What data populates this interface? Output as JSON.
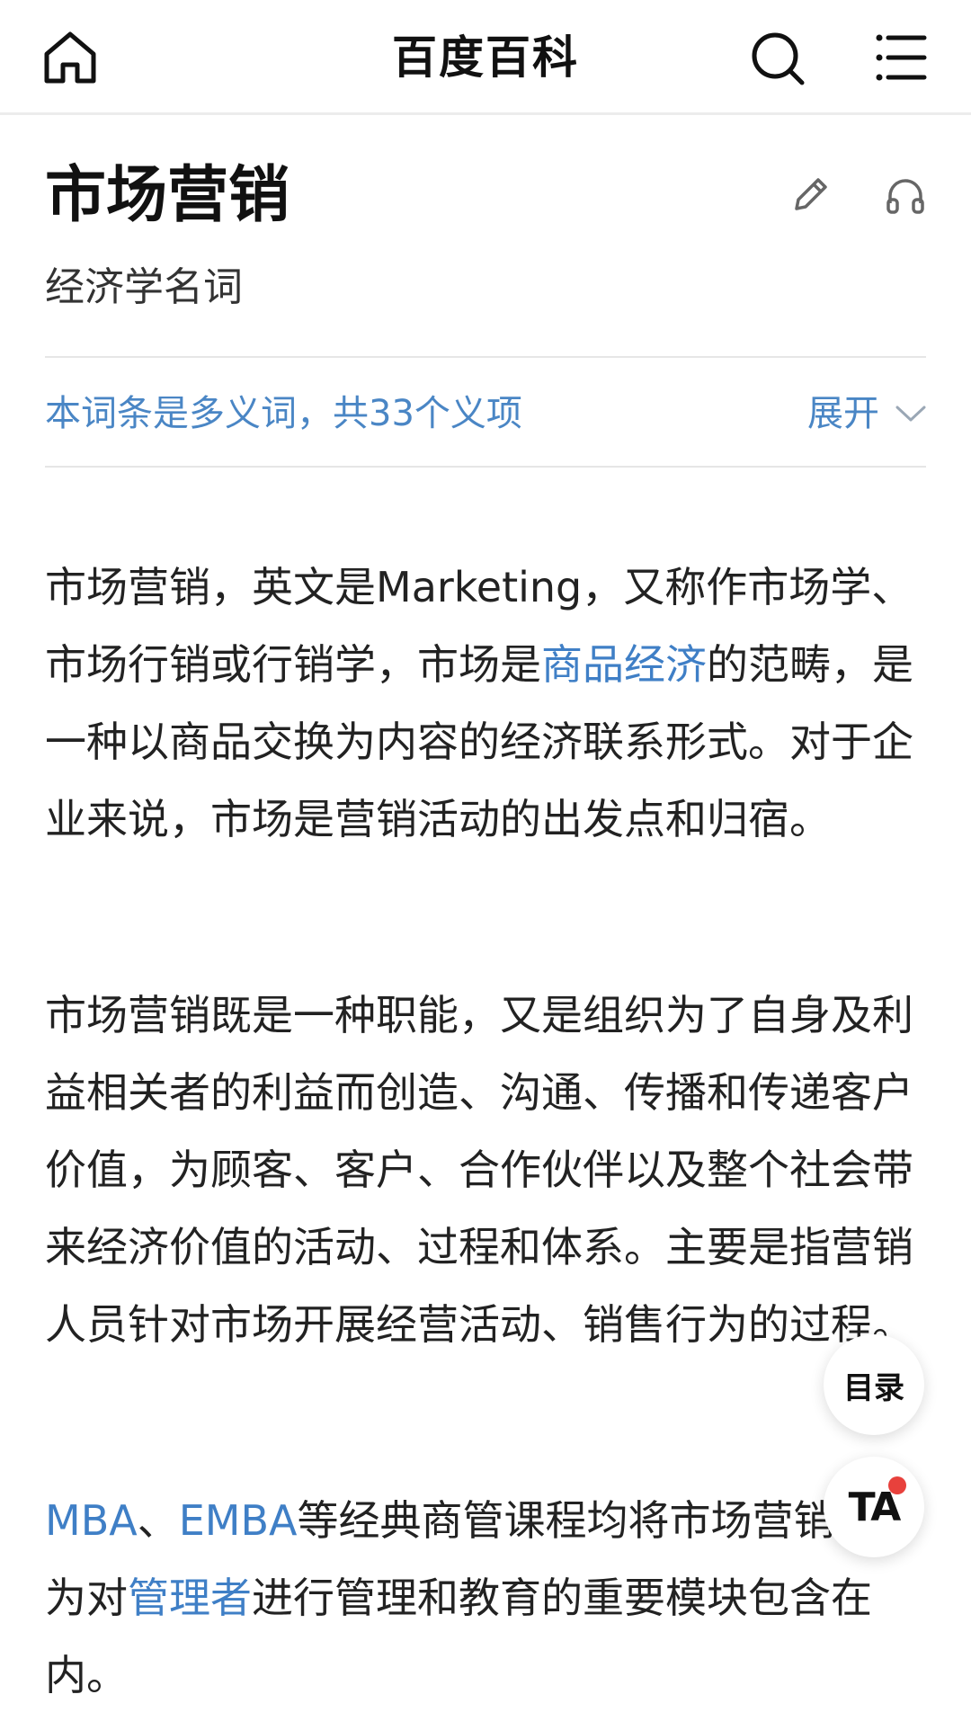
{
  "topbar": {
    "title": "百度百科",
    "home_icon": "home-icon",
    "search_icon": "search-icon",
    "menu_icon": "menu-icon"
  },
  "entry": {
    "title": "市场营销",
    "subtitle": "经济学名词",
    "edit_icon": "pencil-icon",
    "listen_icon": "headphones-icon"
  },
  "polysemy": {
    "text": "本词条是多义词，共33个义项",
    "expand_label": "展开"
  },
  "paragraphs": {
    "p1": {
      "a": "市场营销，英文是Marketing，又称作市场学、市场行销或行销学，市场是",
      "link1": "商品经济",
      "b": "的范畴，是一种以商品交换为内容的经济联系形式。对于企业来说，市场是营销活动的出发点和归宿。"
    },
    "p2": {
      "text": "市场营销既是一种职能，又是组织为了自身及利益相关者的利益而创造、沟通、传播和传递客户价值，为顾客、客户、合作伙伴以及整个社会带来经济价值的活动、过程和体系。主要是指营销人员针对市场开展经营活动、销售行为的过程。"
    },
    "p3": {
      "link_mba": "MBA",
      "sep": "、",
      "link_emba": "EMBA",
      "a": "等经典商管课程均将市场营销作为对",
      "link_manager": "管理者",
      "b": "进行管理和教育的重要模块包含在内。"
    }
  },
  "floating": {
    "toc_label": "目录",
    "ta_label": "TA"
  },
  "colors": {
    "link": "#3f7fc6",
    "polysemy": "#4a86c5",
    "notification_dot": "#e8413c"
  }
}
